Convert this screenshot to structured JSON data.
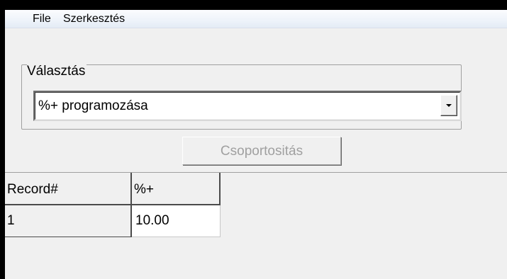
{
  "menu": {
    "items": [
      {
        "label": "File"
      },
      {
        "label": "Szerkesztés"
      }
    ]
  },
  "selection_group": {
    "title": "Választás",
    "combo_value": "%+ programozása"
  },
  "group_button": {
    "label": "Csoportositás",
    "enabled": false
  },
  "grid": {
    "columns": [
      "Record#",
      "%+"
    ],
    "rows": [
      [
        "1",
        "10.00"
      ]
    ]
  },
  "colors": {
    "window_background": "#f0f0f0",
    "disabled_text": "#a0a0a0",
    "menubar": "#eef3fa"
  },
  "icons": {
    "combo_dropdown": "chevron-down-icon"
  }
}
